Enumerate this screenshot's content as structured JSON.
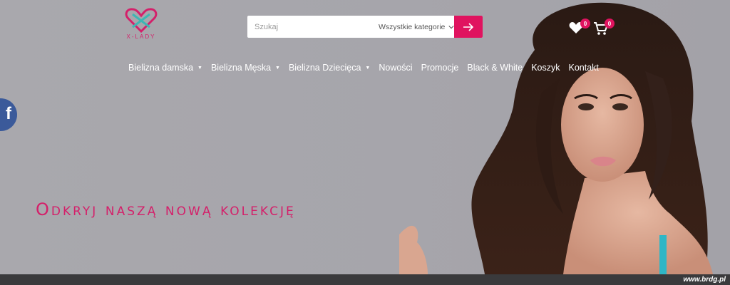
{
  "header": {
    "logo_text": "X-LADY",
    "search": {
      "placeholder": "Szukaj",
      "category": "Wszystkie kategorie"
    },
    "wishlist_count": "0",
    "cart_count": "0"
  },
  "nav": {
    "items": [
      {
        "label": "Bielizna damska",
        "has_dropdown": true
      },
      {
        "label": "Bielizna Męska",
        "has_dropdown": true
      },
      {
        "label": "Bielizna Dziecięca",
        "has_dropdown": true
      },
      {
        "label": "Nowości",
        "has_dropdown": false
      },
      {
        "label": "Promocje",
        "has_dropdown": false
      },
      {
        "label": "Black & White",
        "has_dropdown": false
      },
      {
        "label": "Koszyk",
        "has_dropdown": false
      },
      {
        "label": "Kontakt",
        "has_dropdown": false
      }
    ]
  },
  "hero": {
    "headline": "Odkryj naszą nową kolekcję"
  },
  "social": {
    "facebook_letter": "f"
  },
  "watermark": "www.brdg.pl",
  "colors": {
    "accent": "#e0135f",
    "brand_pink": "#d4206a",
    "background": "#a8a7ac",
    "facebook": "#3b5a9a",
    "bar": "#3a3a3c"
  }
}
